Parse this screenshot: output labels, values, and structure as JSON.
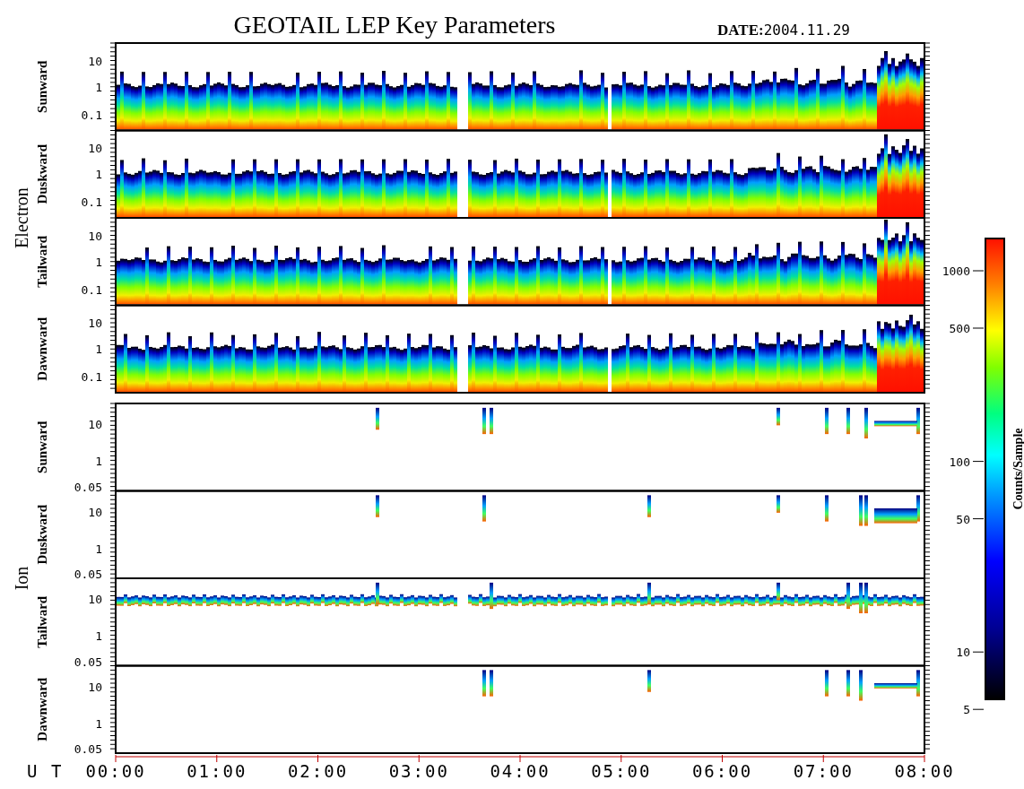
{
  "title": "GEOTAIL LEP Key Parameters",
  "date": {
    "label": "DATE:",
    "value": "2004.11.29"
  },
  "groups": [
    {
      "kind": "electron",
      "name": "Electron",
      "panels": [
        {
          "label": "Sunward",
          "ticks": [
            "10",
            "1",
            "0.1"
          ]
        },
        {
          "label": "Duskward",
          "ticks": [
            "10",
            "1",
            "0.1"
          ]
        },
        {
          "label": "Tailward",
          "ticks": [
            "10",
            "1",
            "0.1"
          ]
        },
        {
          "label": "Dawnward",
          "ticks": [
            "10",
            "1",
            "0.1"
          ]
        }
      ]
    },
    {
      "kind": "ion",
      "name": "Ion",
      "panels": [
        {
          "label": "Sunward",
          "ticks": [
            "10",
            "1",
            "0.05"
          ]
        },
        {
          "label": "Duskward",
          "ticks": [
            "10",
            "1",
            "0.05"
          ]
        },
        {
          "label": "Tailward",
          "ticks": [
            "10",
            "1",
            "0.05"
          ]
        },
        {
          "label": "Dawnward",
          "ticks": [
            "10",
            "1",
            "0.05"
          ]
        }
      ]
    }
  ],
  "x_axis": {
    "label": "U T",
    "ticks": [
      "00:00",
      "01:00",
      "02:00",
      "03:00",
      "04:00",
      "05:00",
      "06:00",
      "07:00",
      "08:00"
    ]
  },
  "colorbar": {
    "label": "Counts/Sample",
    "ticks": [
      "1000",
      "500",
      "100",
      "50",
      "10",
      "5"
    ]
  }
}
